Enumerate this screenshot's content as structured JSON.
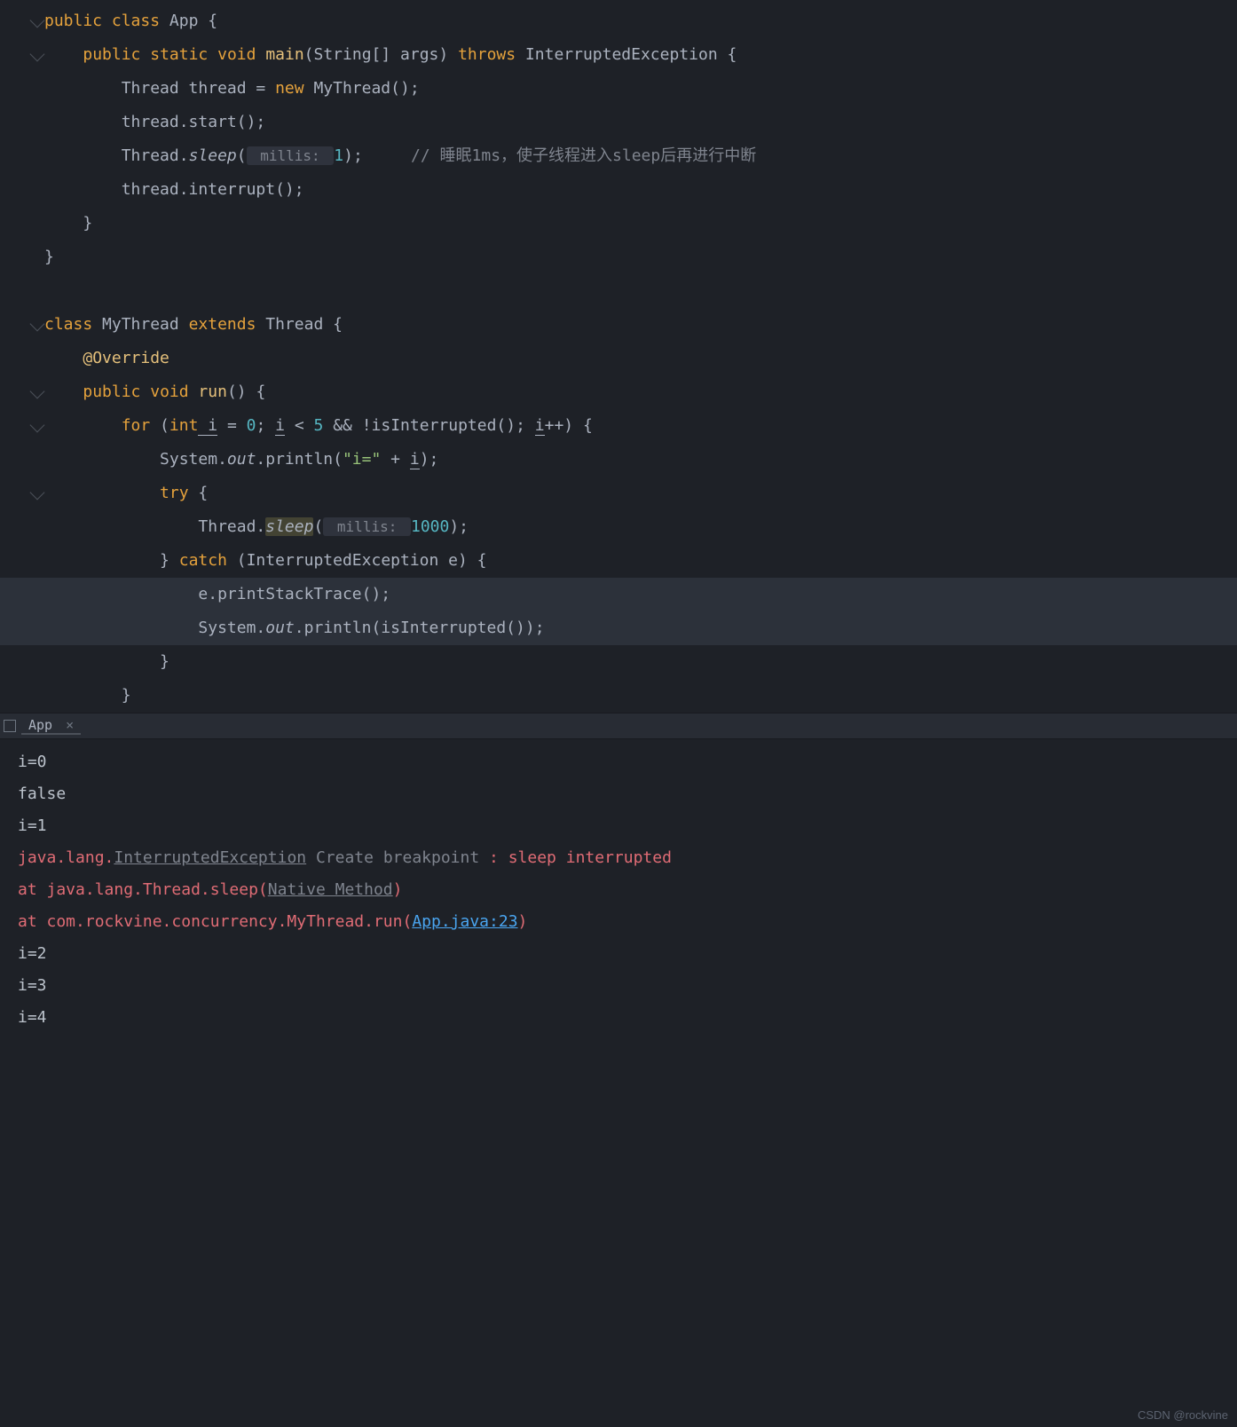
{
  "code": {
    "l1": {
      "kw1": "public",
      "kw2": "class",
      "name": "App",
      "brace": " {"
    },
    "l2": {
      "indent": "    ",
      "kw1": "public",
      "kw2": "static",
      "kw3": "void",
      "name": "main",
      "params_open": "(String[] args) ",
      "kw4": "throws",
      "exc": " InterruptedException {"
    },
    "l3": {
      "indent": "        ",
      "text1": "Thread thread = ",
      "kw": "new",
      "text2": " MyThread();"
    },
    "l4": {
      "indent": "        ",
      "text": "thread.start();"
    },
    "l5": {
      "indent": "        ",
      "text1": "Thread.",
      "method": "sleep",
      "open": "(",
      "hint_label": " millis: ",
      "num": "1",
      "close": ");",
      "gap": "     ",
      "comment": "// 睡眠1ms，使子线程进入sleep后再进行中断"
    },
    "l6": {
      "indent": "        ",
      "text": "thread.interrupt();"
    },
    "l7": {
      "indent": "    ",
      "brace": "}"
    },
    "l8": {
      "brace": "}"
    },
    "l9": {
      "blank": " "
    },
    "l10": {
      "kw1": "class",
      "name": " MyThread ",
      "kw2": "extends",
      "super": " Thread {"
    },
    "l11": {
      "indent": "    ",
      "ann": "@Override"
    },
    "l12": {
      "indent": "    ",
      "kw1": "public",
      "kw2": " void",
      "name": " run",
      "params": "() {"
    },
    "l13": {
      "indent": "        ",
      "kw": "for",
      "open": " (",
      "type": "int",
      "var": " i",
      "eq": " = ",
      "num0": "0",
      "semi1": "; ",
      "var2": "i",
      "cond": " < ",
      "num5": "5",
      "and": " && !isInterrupted(); ",
      "var3": "i",
      "inc": "++) {"
    },
    "l14": {
      "indent": "            ",
      "text1": "System.",
      "out": "out",
      "text2": ".println(",
      "str": "\"i=\"",
      "plus": " + ",
      "var": "i",
      "close": ");"
    },
    "l15": {
      "indent": "            ",
      "kw": "try",
      "brace": " {"
    },
    "l16": {
      "indent": "                ",
      "text1": "Thread.",
      "method": "sleep",
      "open": "(",
      "hint_label": " millis: ",
      "num": "1000",
      "close": ");"
    },
    "l17": {
      "indent": "            ",
      "brace1": "} ",
      "kw": "catch",
      "params": " (InterruptedException e) {"
    },
    "l18": {
      "indent": "                ",
      "text": "e.printStackTrace();"
    },
    "l19": {
      "indent": "                ",
      "text1": "System.",
      "out": "out",
      "text2": ".println(isInterrupted());"
    },
    "l20": {
      "indent": "            ",
      "brace": "}"
    },
    "l21": {
      "indent": "        ",
      "brace": "}"
    }
  },
  "tab": {
    "name": "App",
    "close": "×"
  },
  "console": {
    "l1": "i=0",
    "l2": "false",
    "l3": "i=1",
    "err1_a": "java.lang.",
    "err1_b": "InterruptedException",
    "err1_bp": " Create breakpoint ",
    "err1_c": ": sleep interrupted",
    "err2_a": "    at java.lang.Thread.sleep(",
    "err2_b": "Native Method",
    "err2_c": ")",
    "err3_a": "    at com.rockvine.concurrency.MyThread.run(",
    "err3_b": "App.java:23",
    "err3_c": ")",
    "l5": "i=2",
    "l6": "i=3",
    "l7": "i=4"
  },
  "watermark": "CSDN @rockvine"
}
